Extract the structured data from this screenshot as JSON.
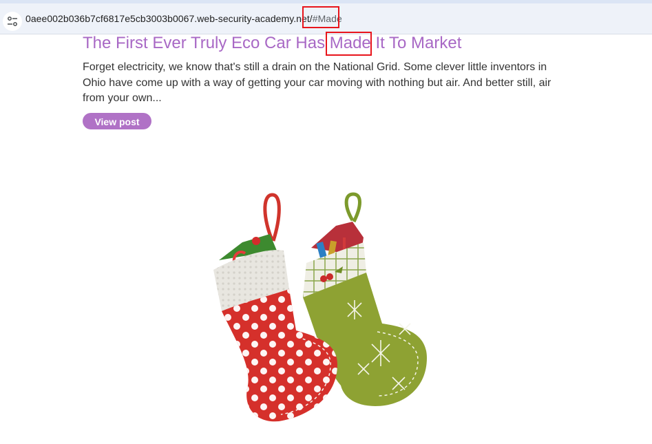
{
  "browser": {
    "url_base": "0aee002b036b7cf6817e5cb3003b0067.web-security-academy.net/",
    "url_fragment": "#Made",
    "site_info_icon": "tune-icon"
  },
  "post": {
    "title": "The First Ever Truly Eco Car Has Made It To Market",
    "excerpt": "Forget electricity, we know that's still a drain on the National Grid. Some clever little inventors in Ohio have come up with a way of getting your car moving with nothing but air. And better still, air from your own...",
    "view_button": "View post",
    "image": "christmas-stockings-image"
  },
  "colors": {
    "title": "#a868c5",
    "button": "#b072c6",
    "highlight": "#e8141b"
  }
}
